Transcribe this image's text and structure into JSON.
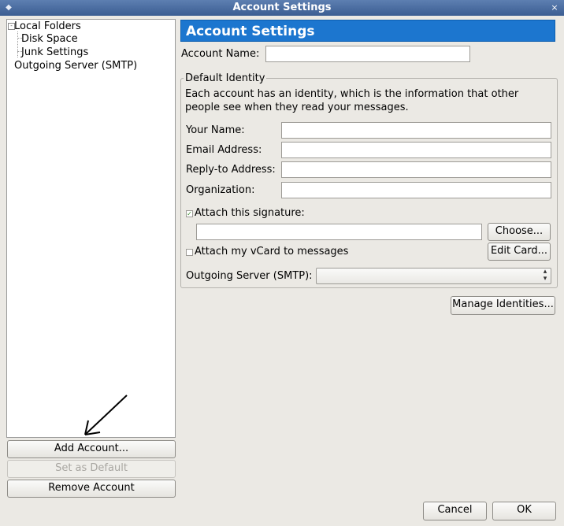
{
  "window": {
    "title": "Account Settings",
    "close_glyph": "×",
    "icon_glyph": "◆"
  },
  "tree": {
    "items": [
      {
        "label": "Local Folders",
        "expanded": true
      },
      {
        "label": "Disk Space"
      },
      {
        "label": "Junk Settings"
      },
      {
        "label": "Outgoing Server (SMTP)"
      }
    ],
    "expander_glyph": "-"
  },
  "left_buttons": {
    "add_account": "Add Account...",
    "set_default": "Set as Default",
    "remove_account": "Remove Account"
  },
  "panel": {
    "header": "Account Settings",
    "account_name_label": "Account Name:",
    "account_name_value": "",
    "identity_legend": "Default Identity",
    "identity_desc_line1": "Each account has an identity, which is the information that other",
    "identity_desc_line2": "people see when they read your messages.",
    "your_name_label": "Your Name:",
    "email_label": "Email Address:",
    "reply_to_label": "Reply-to Address:",
    "organization_label": "Organization:",
    "attach_signature_label": "Attach this signature:",
    "attach_signature_checked": true,
    "signature_path": "",
    "choose_button": "Choose...",
    "attach_vcard_label": "Attach my vCard to messages",
    "attach_vcard_checked": false,
    "edit_card_button": "Edit Card...",
    "outgoing_server_label": "Outgoing Server (SMTP):",
    "outgoing_server_value": "",
    "manage_identities_button": "Manage Identities..."
  },
  "dialog_buttons": {
    "cancel": "Cancel",
    "ok": "OK"
  },
  "colors": {
    "header_bg": "#1c76cf",
    "titlebar": "#3b5d92",
    "check": "#3a8a2a"
  },
  "icons": {
    "checkmark": "✓",
    "dropdown": "⬍"
  }
}
